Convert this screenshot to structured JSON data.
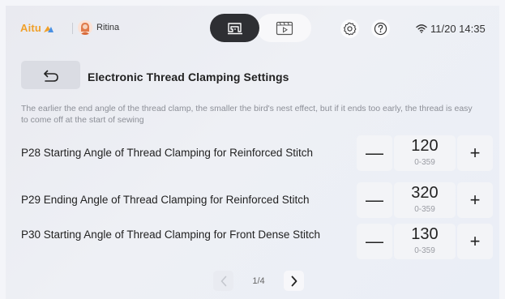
{
  "topbar": {
    "brand": "Aitu",
    "user_name": "Ritina",
    "clock": "11/20 14:35",
    "icons": [
      "brand-logo-icon",
      "avatar",
      "sewing-machine-icon",
      "video-tutorial-icon",
      "gear-icon",
      "help-icon",
      "wifi-icon"
    ]
  },
  "header": {
    "back_icon": "undo-arrow-icon",
    "title": "Electronic Thread Clamping Settings"
  },
  "description": "The earlier the end angle of the thread clamp, the smaller the bird's nest effect, but if it ends too early, the thread is easy to come off at the start of sewing",
  "params": [
    {
      "label": "P28 Starting Angle of Thread Clamping for Reinforced Stitch",
      "value": "120",
      "range": "0-359"
    },
    {
      "label": "P29 Ending Angle of Thread Clamping for Reinforced Stitch",
      "value": "320",
      "range": "0-359"
    },
    {
      "label": "P30 Starting Angle of Thread Clamping for Front Dense Stitch",
      "value": "130",
      "range": "0-359"
    }
  ],
  "stepper_labels": {
    "minus": "—",
    "plus": "+"
  },
  "pagination": {
    "label": "1/4"
  },
  "colors": {
    "brand": "#f0a02a",
    "active_toggle": "#2e2f33",
    "background": "#eceef3"
  }
}
